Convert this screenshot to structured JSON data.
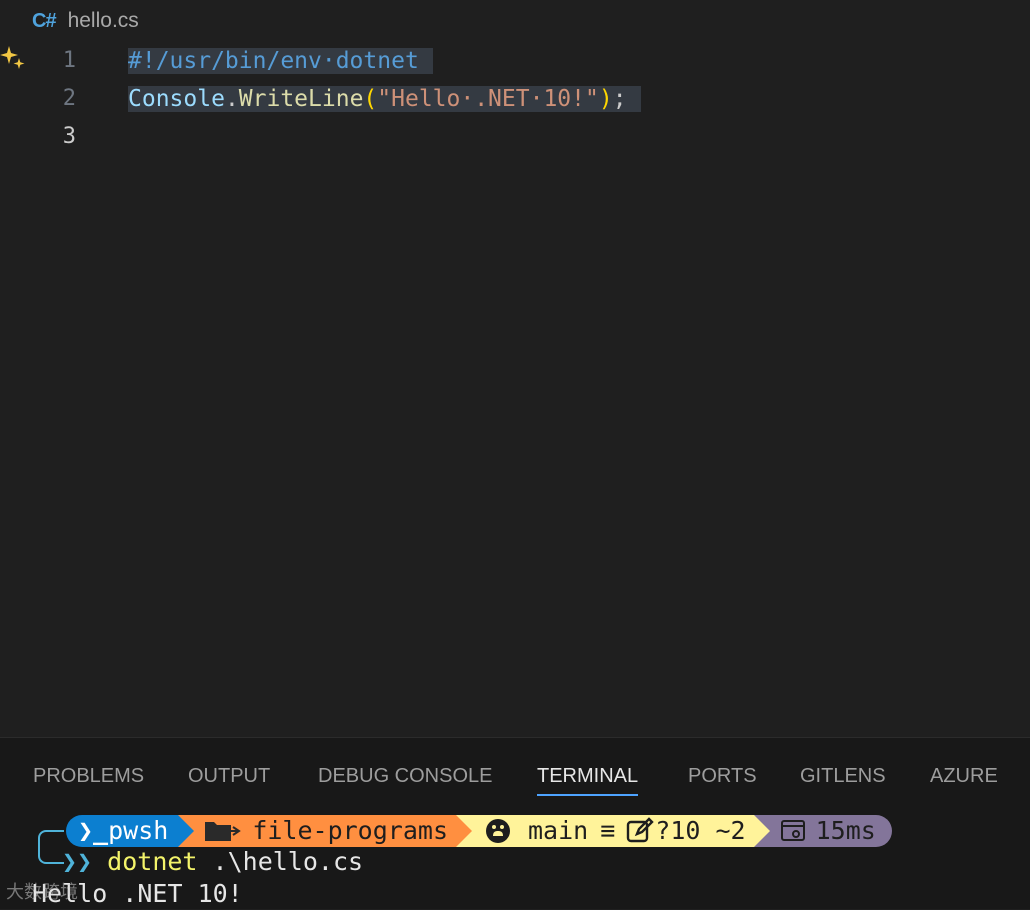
{
  "editor": {
    "file_name": "hello.cs",
    "file_icon_glyph": "C#",
    "line_numbers": [
      "1",
      "2",
      "3"
    ],
    "code": {
      "line1": "#!/usr/bin/env·dotnet",
      "line2_ident": "Console",
      "line2_dot": ".",
      "line2_func": "WriteLine",
      "line2_open": "(",
      "line2_string": "\"Hello·.NET·10!\"",
      "line2_close": ")",
      "line2_semi": ";"
    }
  },
  "panel": {
    "tabs": [
      {
        "label": "PROBLEMS"
      },
      {
        "label": "OUTPUT"
      },
      {
        "label": "DEBUG CONSOLE"
      },
      {
        "label": "TERMINAL"
      },
      {
        "label": "PORTS"
      },
      {
        "label": "GITLENS"
      },
      {
        "label": "AZURE"
      }
    ],
    "active_tab": "TERMINAL"
  },
  "terminal": {
    "prompt": {
      "shell": "pwsh",
      "shell_glyph": "❯_",
      "folder": "file-programs",
      "branch": "main",
      "branch_status": "≡",
      "changes": "?10 ~2",
      "duration": "15ms"
    },
    "command_prompt_glyph": "❯❯",
    "command_name": "dotnet",
    "command_args": ".\\hello.cs",
    "output": "Hello .NET 10!"
  },
  "watermark": "大数跨境",
  "colors": {
    "accent": "#4da3ff",
    "shell_segment": "#0c7fd0",
    "folder_segment": "#ff8f40",
    "git_segment": "#fff39a",
    "time_segment": "#83759a"
  }
}
